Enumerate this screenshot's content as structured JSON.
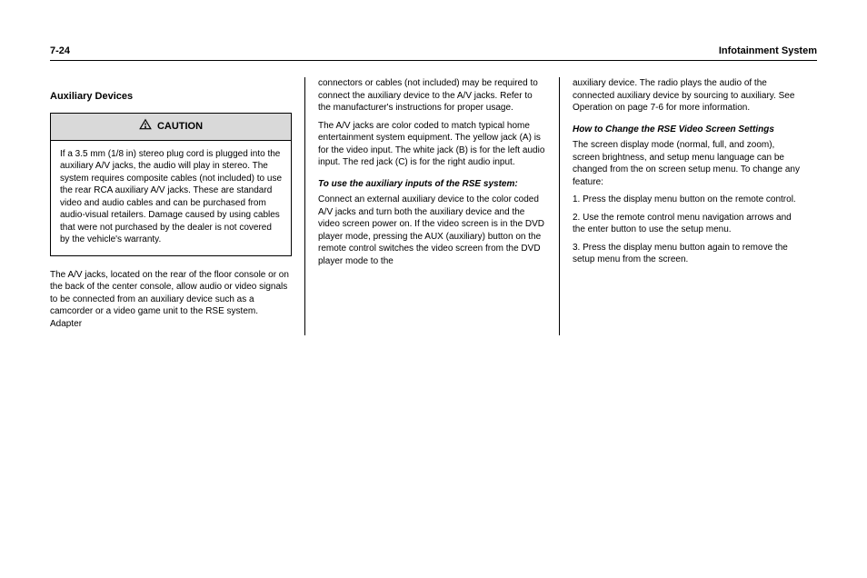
{
  "header": {
    "page_num": "7-24",
    "section": "Infotainment System"
  },
  "columns": [
    {
      "title": "Auxiliary Devices",
      "caution": {
        "label": "CAUTION",
        "body": "If a 3.5 mm (1/8 in) stereo plug cord is plugged into the auxiliary A/V jacks, the audio will play in stereo. The system requires composite cables (not included) to use the rear RCA auxiliary A/V jacks. These are standard video and audio cables and can be purchased from audio-visual retailers. Damage caused by using cables that were not purchased by the dealer is not covered by the vehicle's warranty."
      },
      "after_caution": "The A/V jacks, located on the rear of the floor console or on the back of the center console, allow audio or video signals to be connected from an auxiliary device such as a camcorder or a video game unit to the RSE system. Adapter",
      "sections": []
    },
    {
      "continuation": "connectors or cables (not included) may be required to connect the auxiliary device to the A/V jacks. Refer to the manufacturer's instructions for proper usage.",
      "para2": "The A/V jacks are color coded to match typical home entertainment system equipment. The yellow jack (A) is for the video input. The white jack (B) is for the left audio input. The red jack (C) is for the right audio input.",
      "sections": [
        {
          "heading": "To use the auxiliary inputs of the RSE system:",
          "body": "Connect an external auxiliary device to the color coded A/V jacks and turn both the auxiliary device and the video screen power on. If the video screen is in the DVD player mode, pressing the AUX (auxiliary) button on the remote control switches the video screen from the DVD player mode to the"
        }
      ]
    },
    {
      "continuation": "auxiliary device. The radio plays the audio of the connected auxiliary device by sourcing to auxiliary. See Operation on page 7-6 for more information.",
      "sections": [
        {
          "heading": "How to Change the RSE Video Screen Settings",
          "body": "The screen display mode (normal, full, and zoom), screen brightness, and setup menu language can be changed from the on screen setup menu. To change any feature:"
        },
        {
          "list": [
            "Press the display menu button on the remote control.",
            "Use the remote control menu navigation arrows and the enter button to use the setup menu.",
            "Press the display menu button again to remove the setup menu from the screen."
          ]
        }
      ]
    }
  ]
}
